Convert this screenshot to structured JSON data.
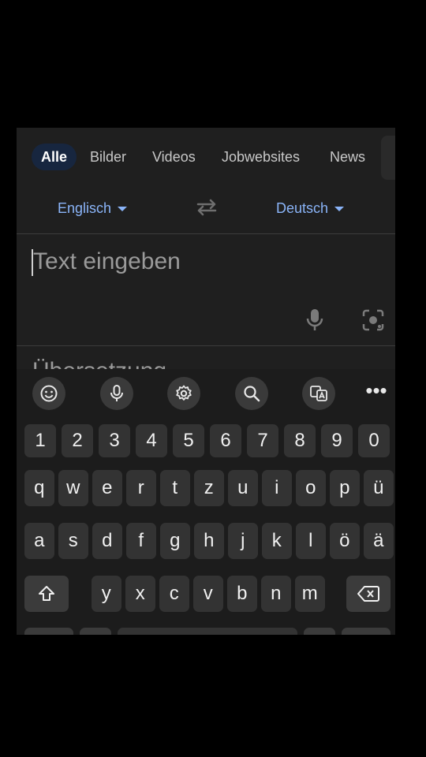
{
  "tabs": [
    {
      "label": "Alle",
      "active": true
    },
    {
      "label": "Bilder"
    },
    {
      "label": "Videos"
    },
    {
      "label": "Jobwebsites"
    },
    {
      "label": "News"
    }
  ],
  "translate": {
    "source_language": "Englisch",
    "target_language": "Deutsch",
    "input_placeholder": "Text eingeben",
    "translation_label": "Übersetzung"
  },
  "keyboard": {
    "toolbar": [
      "emoji-icon",
      "microphone-icon",
      "settings-icon",
      "search-icon",
      "translate-icon",
      "more-icon"
    ],
    "more_label": "•••",
    "row_numbers": [
      "1",
      "2",
      "3",
      "4",
      "5",
      "6",
      "7",
      "8",
      "9",
      "0"
    ],
    "row_top": [
      "q",
      "w",
      "e",
      "r",
      "t",
      "z",
      "u",
      "i",
      "o",
      "p",
      "ü"
    ],
    "row_home": [
      "a",
      "s",
      "d",
      "f",
      "g",
      "h",
      "j",
      "k",
      "l",
      "ö",
      "ä"
    ],
    "row_bottom": [
      "y",
      "x",
      "c",
      "v",
      "b",
      "n",
      "m"
    ],
    "shift_icon": "shift-icon",
    "backspace_icon": "backspace-icon"
  },
  "colors": {
    "accent": "#8ab4f8",
    "active_tab_bg": "#17263f",
    "key_bg": "#333333",
    "panel_bg": "#1f1f1f"
  }
}
